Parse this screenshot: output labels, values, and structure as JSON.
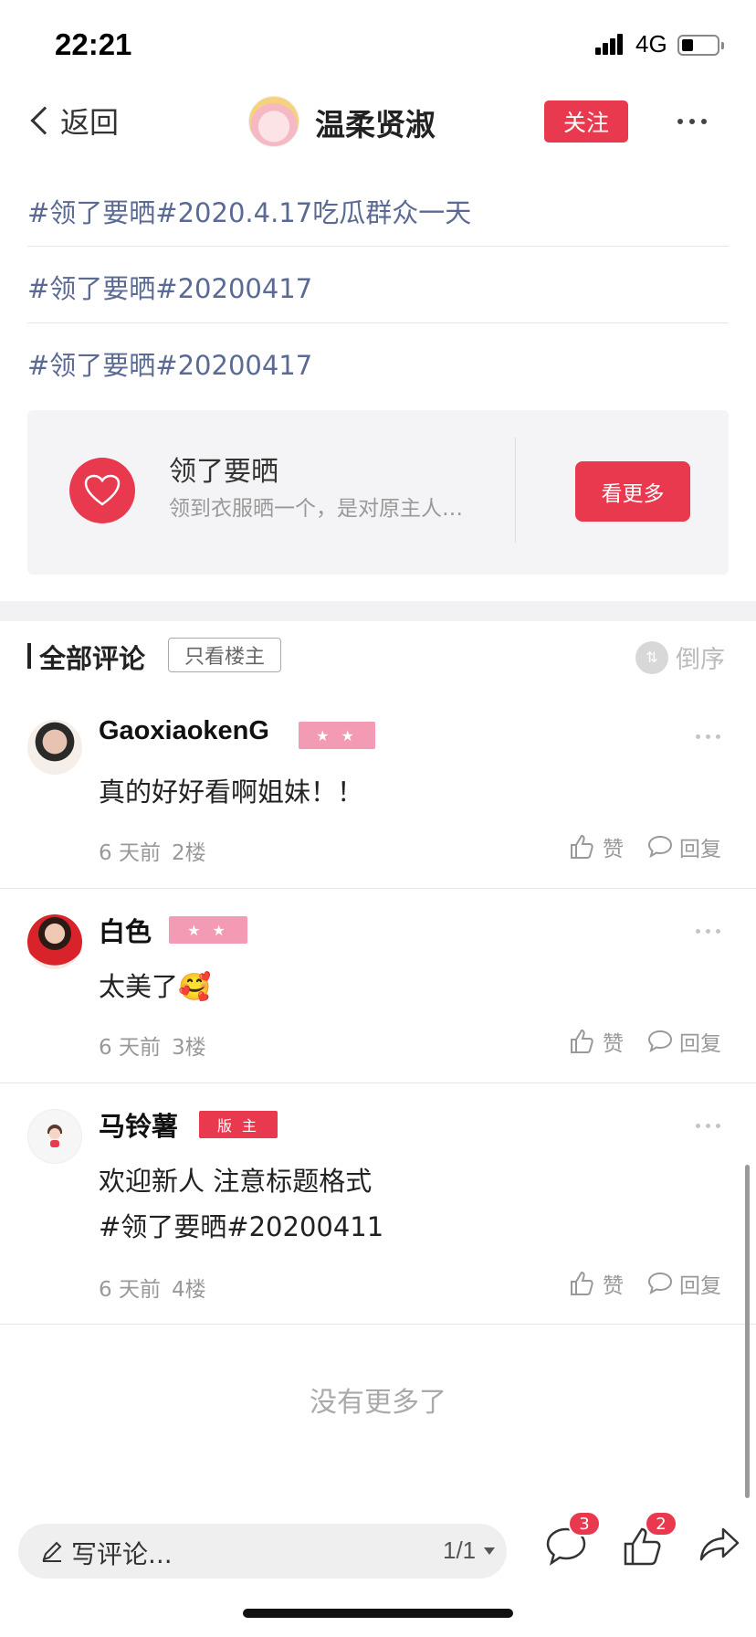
{
  "status_bar": {
    "time": "22:21",
    "network": "4G"
  },
  "nav": {
    "back_label": "返回",
    "title": "温柔贤淑",
    "follow_label": "关注"
  },
  "post": {
    "tags": [
      "#领了要晒#2020.4.17吃瓜群众一天",
      "#领了要晒#20200417",
      "#领了要晒#20200417"
    ]
  },
  "forum_card": {
    "name": "领了要晒",
    "description": "领到衣服晒一个，是对原主人…",
    "see_more_label": "看更多",
    "accent": "#e8394f"
  },
  "comments_header": {
    "title": "全部评论",
    "op_only_label": "只看楼主",
    "sort_label": "倒序"
  },
  "comments": [
    {
      "username": "GaoxiaokenG",
      "badge": "★ ★",
      "text": "真的好好看啊姐妹！！",
      "time": "6 天前",
      "floor": "2楼",
      "like_label": "赞",
      "reply_label": "回复"
    },
    {
      "username": "白色",
      "badge": "★ ★",
      "text": "太美了🥰",
      "time": "6 天前",
      "floor": "3楼",
      "like_label": "赞",
      "reply_label": "回复"
    },
    {
      "username": "马铃薯",
      "badge": "版 主",
      "text_line1": "欢迎新人 注意标题格式",
      "text_line2": "#领了要晒#20200411",
      "time": "6 天前",
      "floor": "4楼",
      "like_label": "赞",
      "reply_label": "回复"
    }
  ],
  "footer": {
    "no_more": "没有更多了",
    "comment_placeholder": "写评论...",
    "page_indicator": "1/1",
    "comment_count": "3",
    "like_count": "2"
  },
  "icons": [
    "back-chevron-icon",
    "more-icon",
    "heart-icon",
    "sort-icon",
    "thumbs-up-icon",
    "reply-bubble-icon",
    "pencil-icon",
    "comment-icon",
    "share-icon"
  ]
}
